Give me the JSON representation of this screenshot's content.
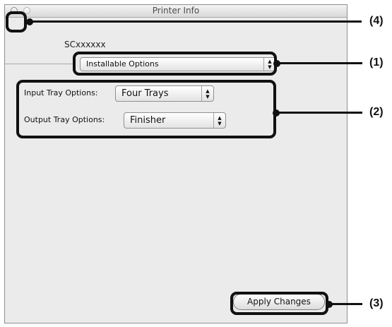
{
  "window": {
    "title": "Printer Info",
    "printer_name": "SCxxxxxx"
  },
  "panel_select": {
    "value": "Installable Options",
    "icon": "stepper-arrows-icon"
  },
  "input_tray": {
    "label": "Input Tray Options:",
    "value": "Four Trays"
  },
  "output_tray": {
    "label": "Output Tray Options:",
    "value": "Finisher"
  },
  "apply_button": {
    "label": "Apply Changes"
  },
  "callouts": {
    "close": "(4)",
    "panel": "(1)",
    "options": "(2)",
    "apply": "(3)"
  }
}
